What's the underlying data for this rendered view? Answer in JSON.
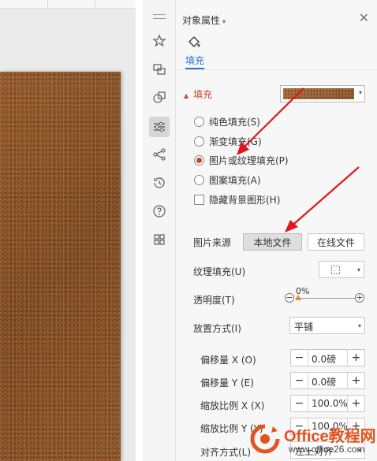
{
  "colors": {
    "accent_blue": "#2b74c8",
    "section_red": "#c8472d",
    "leather": "#8a5127",
    "arrow_red": "#e0161c",
    "watermark_orange": "#e2541f"
  },
  "rail": {
    "icons": [
      "star-shapes-icon",
      "swap-icon",
      "shapes-icon",
      "sliders-icon",
      "share-icon",
      "history-icon",
      "help-icon",
      "grid-icon"
    ],
    "active": "sliders-icon"
  },
  "panel": {
    "title": "对象属性",
    "tab_label": "填充",
    "section_label": "填充",
    "fill_options": [
      {
        "label": "纯色填充(S)",
        "checked": false
      },
      {
        "label": "渐变填充(G)",
        "checked": false
      },
      {
        "label": "图片或纹理填充(P)",
        "checked": true
      },
      {
        "label": "图案填充(A)",
        "checked": false
      }
    ],
    "hide_background_label": "隐藏背景图形(H)",
    "image_source_label": "图片来源",
    "local_file_button": "本地文件",
    "online_file_button": "在线文件",
    "texture_fill_label": "纹理填充(U)",
    "transparency_label": "透明度(T)",
    "transparency_value": "0%",
    "placement_label": "放置方式(I)",
    "placement_value": "平铺",
    "offset_x_label": "偏移量 X (O)",
    "offset_x_value": "0.0磅",
    "offset_y_label": "偏移量 Y (E)",
    "offset_y_value": "0.0磅",
    "scale_x_label": "缩放比例 X (X)",
    "scale_x_value": "100.0%",
    "scale_y_label": "缩放比例 Y (Y)",
    "scale_y_value": "100.0%",
    "align_label": "对齐方式(L)",
    "align_value": "左上对齐"
  },
  "watermark": {
    "brand": "Office教程网",
    "url": "www.office26.com"
  }
}
